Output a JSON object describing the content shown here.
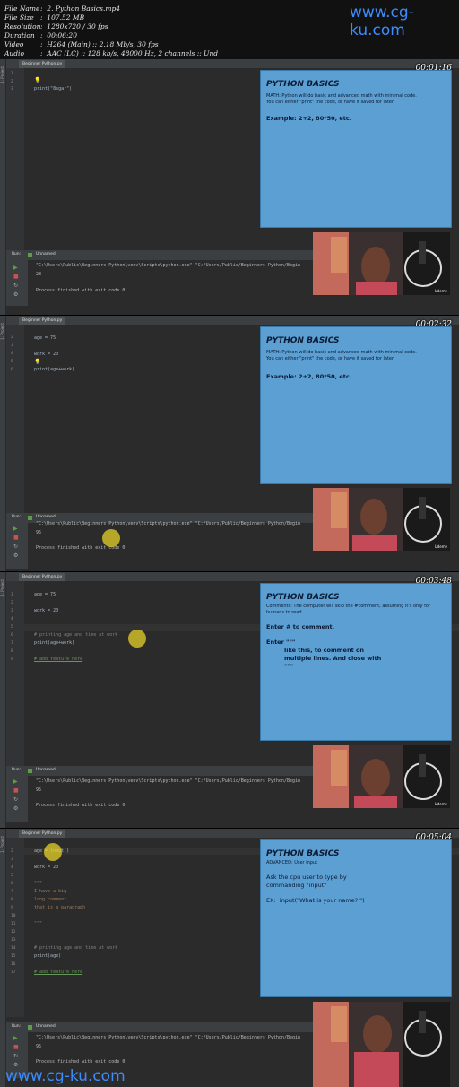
{
  "header": {
    "fields": [
      {
        "key": "File Name",
        "value": ":  2. Python Basics.mp4"
      },
      {
        "key": "File Size",
        "value": ":  107.52 MB"
      },
      {
        "key": "Resolution",
        "value": ":  1280x720 / 30 fps"
      },
      {
        "key": "Duration",
        "value": ":  00:06:20"
      },
      {
        "key": "Video",
        "value": ":  H264 (Main) :: 2.18 Mb/s, 30 fps"
      },
      {
        "key": "Audio",
        "value": ":  AAC (LC) :: 128 kb/s, 48000 Hz, 2 channels :: Und"
      }
    ],
    "watermark_top": "www.cg-ku.com"
  },
  "watermark_bottom": "www.cg-ku.com",
  "editor": {
    "tab": "Beginner Python.py",
    "project_label": "1: Project",
    "run_label": "Run:",
    "run_config": "Unnamed",
    "command": "\"C:\\Users\\Public\\Beginners Python\\venv\\Scripts\\python.exe\" \"C:/Users/Public/Beginners Python/Begin",
    "finished": "Process finished with exit code 0"
  },
  "frames": [
    {
      "timestamp": "00:01:16",
      "lines": [
        "1",
        "2",
        "3"
      ],
      "code": [
        "print(\"8sgar\")"
      ],
      "output": "28",
      "slide": {
        "title": "PYTHON BASICS",
        "text": [
          "MATH: Python will do basic and advanced math with minimal code.",
          "You can either \"print\" the code, or have it saved for later."
        ],
        "bold": [
          "Example: 2+2, 80*50, etc."
        ]
      }
    },
    {
      "timestamp": "00:02:32",
      "lines": [
        "1",
        "2",
        "3",
        "4",
        "5",
        "6"
      ],
      "code": [
        "age = 75",
        "work = 20",
        "print(age+work)"
      ],
      "output": "95",
      "slide": {
        "title": "PYTHON BASICS",
        "text": [
          "MATH: Python will do basic and advanced math with minimal code.",
          "You can either \"print\" the code, or have it saved for later."
        ],
        "bold": [
          "Example: 2+2, 80*50, etc."
        ]
      }
    },
    {
      "timestamp": "00:03:48",
      "lines": [
        "1",
        "2",
        "3",
        "4",
        "5",
        "6",
        "7",
        "8",
        "9",
        "10"
      ],
      "code": [
        "age = 75",
        "work = 20",
        "# printing age and time at work",
        "print(age+work)",
        "# add feature here"
      ],
      "output": "95",
      "slide": {
        "title": "PYTHON BASICS",
        "text": [
          "Comments: The computer will skip the #comment, assuming it's only for",
          "humans to read."
        ],
        "bold": [
          "Enter # to comment.",
          "Enter \"\"\"",
          "like this, to comment on",
          "multiple lines. And close with",
          "\"\"\""
        ]
      }
    },
    {
      "timestamp": "00:05:04",
      "lines": [
        "1",
        "2",
        "3",
        "4",
        "5",
        "6",
        "7",
        "8",
        "9",
        "10",
        "11",
        "12",
        "13",
        "14",
        "15",
        "16",
        "17"
      ],
      "code": [
        "age = input()",
        "work = 20",
        "\"\"\"",
        "I have a big",
        "long comment",
        "that is a paragraph",
        "\"\"\"",
        "# printing age and time at work",
        "print(age)",
        "# add feature here"
      ],
      "output": "95",
      "slide": {
        "title": "PYTHON BASICS",
        "text": [
          "ADVANCED: User input"
        ],
        "medium": [
          "Ask the cpu user to type by",
          "commanding \"input\"",
          "EX:  input(\"What is your name? \")"
        ]
      }
    }
  ],
  "colors": {
    "slide_bg": "#5b9fd3",
    "editor_bg": "#2b2b2b",
    "watermark": "#3c8cff",
    "cursor": "#e6d228"
  },
  "icons": [
    "run-icon",
    "stop-icon",
    "rerun-icon",
    "lightbulb-icon",
    "udemy-logo-icon"
  ]
}
